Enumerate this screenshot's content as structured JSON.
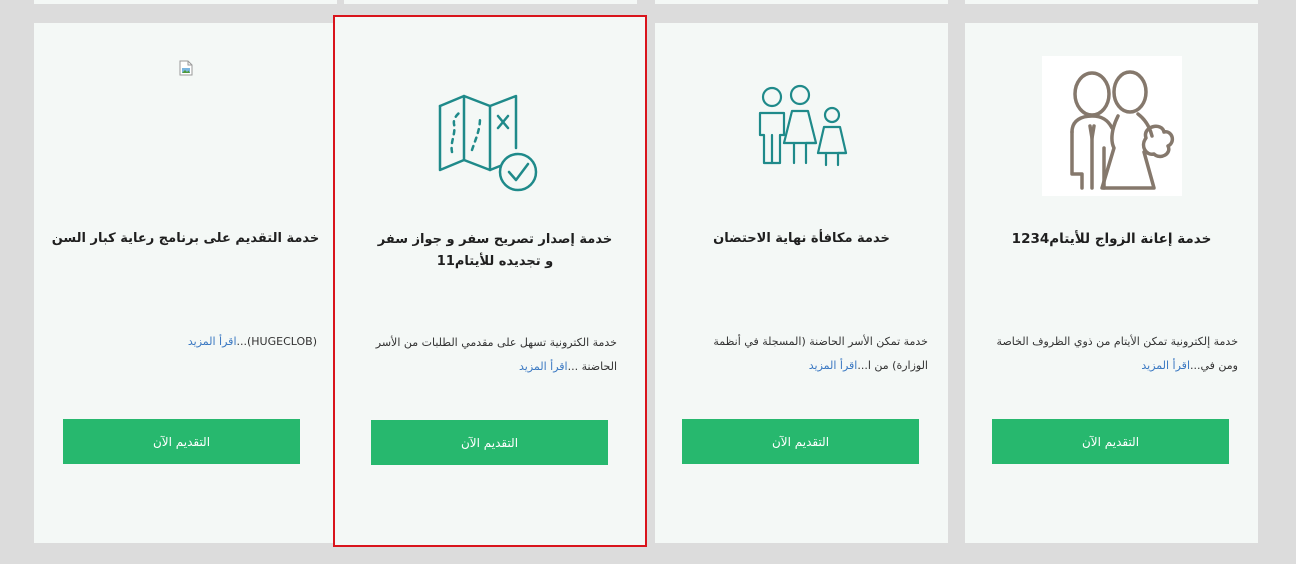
{
  "colors": {
    "page_bg": "#dcdcdc",
    "card_bg": "#f4f8f6",
    "button_bg": "#27b86e",
    "link": "#3a78c2",
    "selection_outline": "#d9141c",
    "icon_teal": "#1f8a8a",
    "icon_brown": "#85786c"
  },
  "cards": [
    {
      "icon": "broken-image-icon",
      "title": "خدمة التقديم على برنامج رعاية كبار السن",
      "description": "(HUGECLOB)...",
      "read_more": "اقرأ المزيد",
      "button": "التقديم الآن",
      "selected": false
    },
    {
      "icon": "map-check-icon",
      "title": "خدمة إصدار تصريح سفر و جواز سفر و تجديده للأيتام11",
      "description": "خدمة الكترونية تسهل على مقدمي الطلبات من الأسر الحاضنة ...",
      "read_more": "اقرأ المزيد",
      "button": "التقديم الآن",
      "selected": true
    },
    {
      "icon": "children-icon",
      "title": "خدمة مكافأة نهاية الاحتضان",
      "description": "خدمة تمكن الأسر الحاضنة (المسجلة في أنظمة الوزارة) من ا...",
      "read_more": "اقرأ المزيد",
      "button": "التقديم الآن",
      "selected": false
    },
    {
      "icon": "wedding-couple-icon",
      "title": "خدمة إعانة الزواج للأيتام1234",
      "description": "خدمة إلكترونية تمكن الأيتام من ذوي الظروف الخاصة ومن في...",
      "read_more": "اقرأ المزيد",
      "button": "التقديم الآن",
      "selected": false
    }
  ]
}
